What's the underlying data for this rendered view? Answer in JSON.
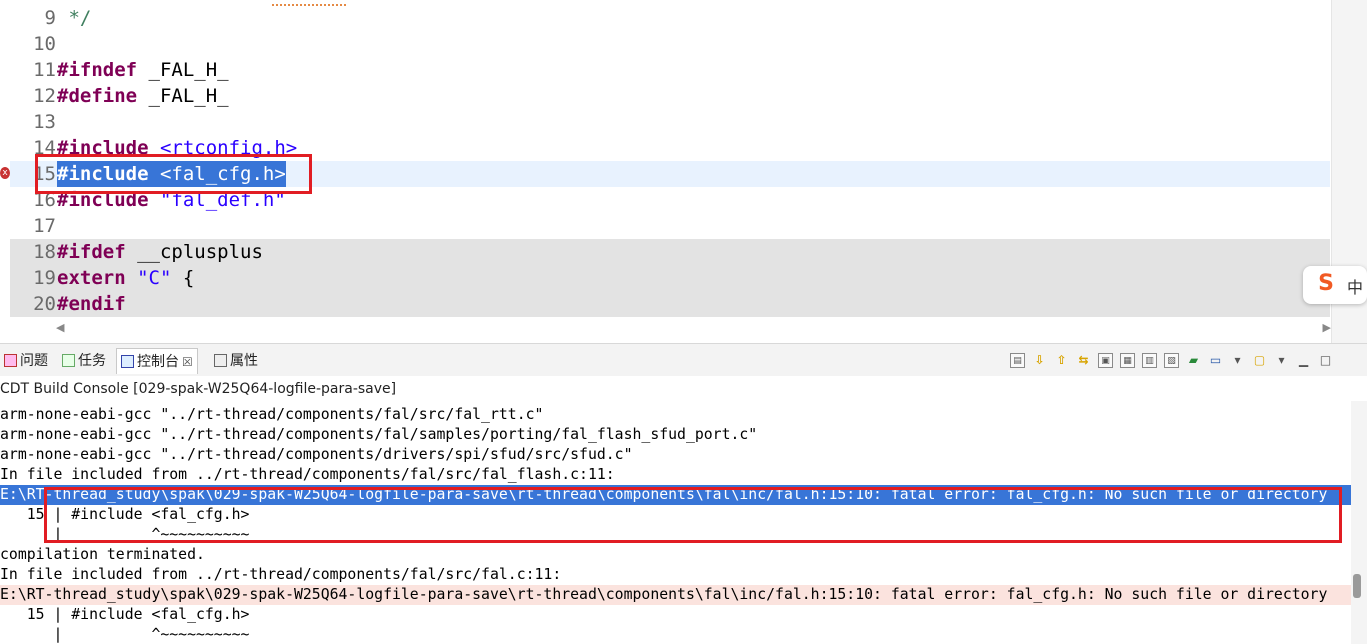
{
  "editor": {
    "lines": [
      {
        "num": "9",
        "segments": [
          {
            "text": " */",
            "cls": "cmt"
          }
        ]
      },
      {
        "num": "10",
        "segments": []
      },
      {
        "num": "11",
        "segments": [
          {
            "text": "#ifndef",
            "cls": "kw"
          },
          {
            "text": " _FAL_H_",
            "cls": ""
          }
        ]
      },
      {
        "num": "12",
        "segments": [
          {
            "text": "#define",
            "cls": "kw"
          },
          {
            "text": " _FAL_H_",
            "cls": ""
          }
        ]
      },
      {
        "num": "13",
        "segments": []
      },
      {
        "num": "14",
        "segments": [
          {
            "text": "#include",
            "cls": "kw"
          },
          {
            "text": " ",
            "cls": ""
          },
          {
            "text": "<rtconfig.h>",
            "cls": "str"
          }
        ]
      },
      {
        "num": "15",
        "segments": [
          {
            "text": "#include",
            "cls": "kw"
          },
          {
            "text": " <fal_cfg.h>",
            "cls": ""
          }
        ]
      },
      {
        "num": "16",
        "segments": [
          {
            "text": "#include",
            "cls": "kw"
          },
          {
            "text": " ",
            "cls": ""
          },
          {
            "text": "\"fal_def.h\"",
            "cls": "str"
          }
        ]
      },
      {
        "num": "17",
        "segments": []
      },
      {
        "num": "18",
        "segments": [
          {
            "text": "#ifdef",
            "cls": "kw"
          },
          {
            "text": " __cplusplus",
            "cls": ""
          }
        ]
      },
      {
        "num": "19",
        "segments": [
          {
            "text": "extern",
            "cls": "kw"
          },
          {
            "text": " ",
            "cls": ""
          },
          {
            "text": "\"C\"",
            "cls": "str"
          },
          {
            "text": " {",
            "cls": ""
          }
        ]
      },
      {
        "num": "20",
        "segments": [
          {
            "text": "#endif",
            "cls": "kw"
          }
        ]
      }
    ],
    "error_marker": "x",
    "scroll_left": "◀",
    "scroll_right": "▶"
  },
  "ime": {
    "logo": "S",
    "lang": "中"
  },
  "panel": {
    "tabs": [
      {
        "label": "问题",
        "icon": "problems-icon"
      },
      {
        "label": "任务",
        "icon": "tasks-icon"
      },
      {
        "label": "控制台",
        "icon": "console-icon",
        "active": true,
        "close": "☒"
      },
      {
        "label": "属性",
        "icon": "properties-icon"
      }
    ],
    "toolbar": [
      {
        "name": "clear-console-icon",
        "glyph": "▤",
        "cls": "box"
      },
      {
        "name": "scroll-lock-down-icon",
        "glyph": "⇩",
        "cls": "yel"
      },
      {
        "name": "scroll-lock-up-icon",
        "glyph": "⇧",
        "cls": "yel"
      },
      {
        "name": "word-wrap-icon",
        "glyph": "⇆",
        "cls": "yel"
      },
      {
        "name": "copy-icon",
        "glyph": "▣",
        "cls": "box"
      },
      {
        "name": "lock-icon",
        "glyph": "▦",
        "cls": "box"
      },
      {
        "name": "pin-icon",
        "glyph": "▥",
        "cls": "box"
      },
      {
        "name": "save-log-icon",
        "glyph": "▧",
        "cls": "box"
      },
      {
        "name": "open-console-icon",
        "glyph": "▰",
        "cls": "grn"
      },
      {
        "name": "display-console-icon",
        "glyph": "▭",
        "cls": "blu"
      },
      {
        "name": "dropdown-icon",
        "glyph": "▾",
        "cls": ""
      },
      {
        "name": "new-console-icon",
        "glyph": "▢",
        "cls": "yel"
      },
      {
        "name": "dropdown-icon",
        "glyph": "▾",
        "cls": ""
      },
      {
        "name": "minimize-icon",
        "glyph": "▁",
        "cls": ""
      },
      {
        "name": "maximize-icon",
        "glyph": "□",
        "cls": ""
      }
    ]
  },
  "console": {
    "title": "CDT Build Console [029-spak-W25Q64-logfile-para-save]",
    "lines": [
      {
        "text": "arm-none-eabi-gcc \"../rt-thread/components/fal/src/fal_rtt.c\"",
        "style": ""
      },
      {
        "text": "arm-none-eabi-gcc \"../rt-thread/components/fal/samples/porting/fal_flash_sfud_port.c\"",
        "style": ""
      },
      {
        "text": "arm-none-eabi-gcc \"../rt-thread/components/drivers/spi/sfud/src/sfud.c\"",
        "style": ""
      },
      {
        "text": "In file included from ../rt-thread/components/fal/src/fal_flash.c:11:",
        "style": ""
      },
      {
        "text": "E:\\RT-thread_study\\spak\\029-spak-W25Q64-logfile-para-save\\rt-thread\\components\\fal\\inc/fal.h:15:10: fatal error: fal_cfg.h: No such file or directory",
        "style": "selbg"
      },
      {
        "text": "   15 | #include <fal_cfg.h>",
        "style": ""
      },
      {
        "text": "      |          ^~~~~~~~~~~",
        "style": ""
      },
      {
        "text": "compilation terminated.",
        "style": ""
      },
      {
        "text": "In file included from ../rt-thread/components/fal/src/fal.c:11:",
        "style": ""
      },
      {
        "text": "E:\\RT-thread_study\\spak\\029-spak-W25Q64-logfile-para-save\\rt-thread\\components\\fal\\inc/fal.h:15:10: fatal error: fal_cfg.h: No such file or directory",
        "style": "errbg"
      },
      {
        "text": "   15 | #include <fal_cfg.h>",
        "style": ""
      },
      {
        "text": "      |          ^~~~~~~~~~~",
        "style": ""
      }
    ]
  }
}
